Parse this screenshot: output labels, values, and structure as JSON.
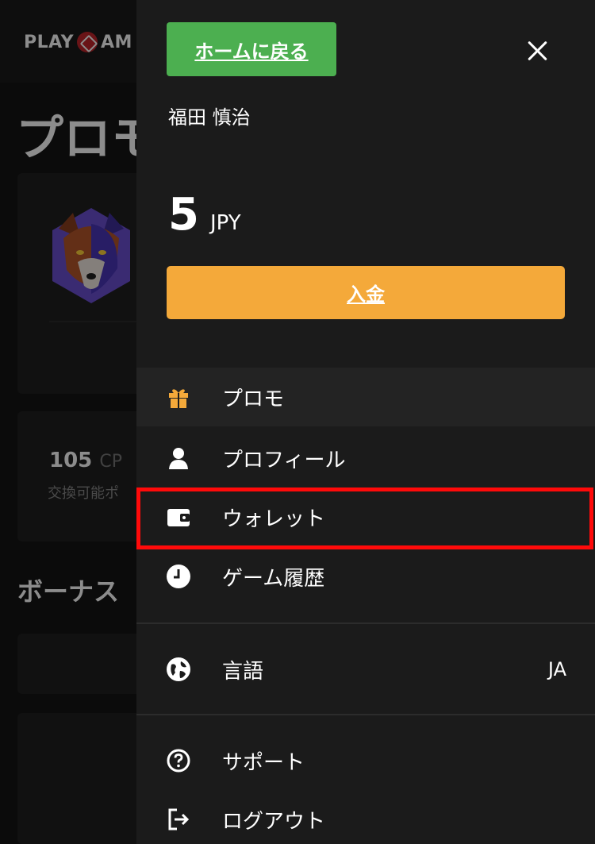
{
  "background": {
    "logo_text": "PLAY",
    "logo_suffix": "AM",
    "page_title": "プロモ",
    "points_value": "105",
    "points_unit": "CP",
    "points_sub": "交換可能ポ",
    "bonus_heading": "ボーナス"
  },
  "drawer": {
    "home_label": "ホームに戻る",
    "user_name": "福田 慎治",
    "balance_amount": "5",
    "balance_currency": "JPY",
    "deposit_label": "入金",
    "menu": [
      {
        "label": "プロモ",
        "icon": "gift-icon"
      },
      {
        "label": "プロフィール",
        "icon": "user-icon"
      },
      {
        "label": "ウォレット",
        "icon": "wallet-icon"
      },
      {
        "label": "ゲーム履歴",
        "icon": "clock-icon"
      }
    ],
    "settings": [
      {
        "label": "言語",
        "icon": "globe-icon",
        "value": "JA"
      }
    ],
    "support": [
      {
        "label": "サポート",
        "icon": "help-icon"
      },
      {
        "label": "ログアウト",
        "icon": "logout-icon"
      }
    ]
  },
  "colors": {
    "home_button": "#4caf50",
    "deposit_button": "#f4a93a",
    "highlight": "#ff0a0a",
    "gift_icon": "#f4a93a"
  }
}
